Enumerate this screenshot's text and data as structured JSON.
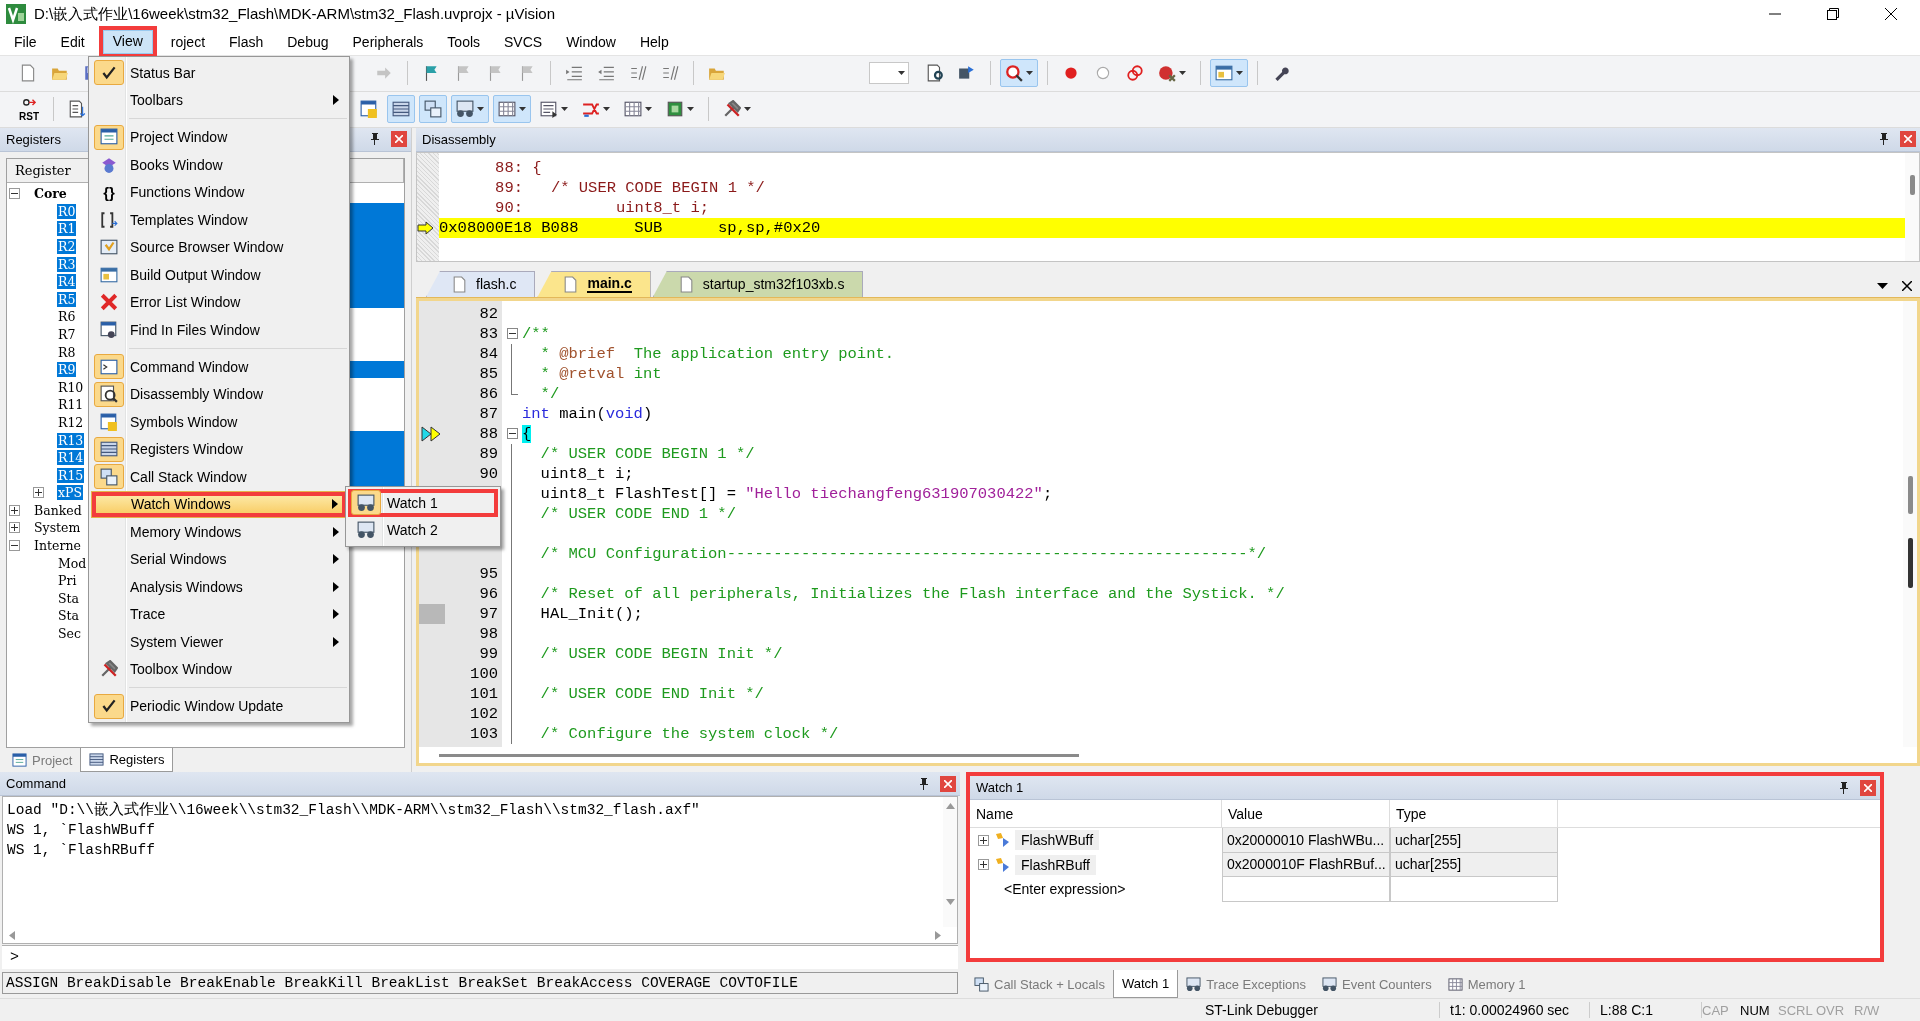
{
  "window": {
    "title": "D:\\嵌入式作业\\16week\\stm32_Flash\\MDK-ARM\\stm32_Flash.uvprojx - µVision"
  },
  "menu_bar": [
    {
      "label": "File",
      "selected": false,
      "highlighted": false
    },
    {
      "label": "Edit",
      "selected": false,
      "highlighted": false
    },
    {
      "label": "View",
      "selected": true,
      "highlighted": true
    },
    {
      "label": "roject",
      "selected": false,
      "highlighted": false
    },
    {
      "label": "Flash",
      "selected": false,
      "highlighted": false
    },
    {
      "label": "Debug",
      "selected": false,
      "highlighted": false
    },
    {
      "label": "Peripherals",
      "selected": false,
      "highlighted": false
    },
    {
      "label": "Tools",
      "selected": false,
      "highlighted": false
    },
    {
      "label": "SVCS",
      "selected": false,
      "highlighted": false
    },
    {
      "label": "Window",
      "selected": false,
      "highlighted": false
    },
    {
      "label": "Help",
      "selected": false,
      "highlighted": false
    }
  ],
  "toolbars": [
    {
      "left": [
        {
          "kind": "new",
          "pressed": false
        },
        {
          "kind": "open",
          "pressed": false
        },
        {
          "kind": "save",
          "pressed": false
        }
      ],
      "right": [
        {
          "kind": "arrow",
          "pressed": false
        },
        {
          "kind": "sep"
        },
        {
          "kind": "flag",
          "pressed": false
        },
        {
          "kind": "flag-grey",
          "pressed": false
        },
        {
          "kind": "flag-grey",
          "pressed": false
        },
        {
          "kind": "flag-grey",
          "pressed": false
        },
        {
          "kind": "sep"
        },
        {
          "kind": "indent",
          "pressed": false
        },
        {
          "kind": "outdent",
          "pressed": false
        },
        {
          "kind": "slash",
          "pressed": false
        },
        {
          "kind": "slash",
          "pressed": false
        },
        {
          "kind": "sep"
        },
        {
          "kind": "open",
          "pressed": false
        },
        {
          "kind": "combo"
        },
        {
          "kind": "docsearch",
          "pressed": false
        },
        {
          "kind": "download",
          "pressed": false
        },
        {
          "kind": "sep"
        },
        {
          "kind": "debug",
          "pressed": true,
          "dropdown": true
        },
        {
          "kind": "sep"
        },
        {
          "kind": "dot",
          "pressed": false
        },
        {
          "kind": "circle",
          "pressed": false
        },
        {
          "kind": "rings",
          "pressed": false
        },
        {
          "kind": "killdot",
          "pressed": false,
          "dropdown": true
        },
        {
          "kind": "sep"
        },
        {
          "kind": "window",
          "pressed": true,
          "dropdown": true
        },
        {
          "kind": "sep"
        },
        {
          "kind": "wrench",
          "pressed": false
        }
      ]
    },
    {
      "left": [
        {
          "kind": "reset",
          "pressed": false,
          "label": "RST"
        },
        {
          "kind": "sep"
        },
        {
          "kind": "step",
          "pressed": false
        }
      ],
      "right": [
        {
          "kind": "symbols",
          "pressed": false
        },
        {
          "kind": "registers",
          "pressed": true
        },
        {
          "kind": "stack",
          "pressed": true
        },
        {
          "kind": "spectacles",
          "pressed": true,
          "dropdown": true
        },
        {
          "kind": "grid",
          "pressed": true,
          "dropdown": true
        },
        {
          "kind": "doclines",
          "pressed": false,
          "dropdown": true
        },
        {
          "kind": "arrows",
          "pressed": false,
          "dropdown": true
        },
        {
          "kind": "grid",
          "pressed": false,
          "dropdown": true
        },
        {
          "kind": "chip",
          "pressed": false,
          "dropdown": true
        },
        {
          "kind": "sep"
        },
        {
          "kind": "tools",
          "pressed": false,
          "dropdown": true
        }
      ]
    }
  ],
  "view_menu": {
    "items": [
      {
        "kind": "item",
        "label": "Status Bar",
        "framed": true,
        "selected": false,
        "highlighted": false
      },
      {
        "kind": "submenu",
        "label": "Toolbars",
        "selected": false,
        "highlighted": false
      },
      {
        "kind": "separator"
      },
      {
        "kind": "item",
        "label": "Project Window",
        "framed": true,
        "selected": false,
        "highlighted": false
      },
      {
        "kind": "item",
        "label": "Books Window",
        "framed": false,
        "selected": false,
        "highlighted": false
      },
      {
        "kind": "item",
        "label": "Functions Window",
        "glyph": "{}",
        "framed": false,
        "selected": false,
        "highlighted": false
      },
      {
        "kind": "item",
        "label": "Templates Window",
        "framed": false,
        "selected": false,
        "highlighted": false
      },
      {
        "kind": "item",
        "label": "Source Browser Window",
        "framed": false,
        "selected": false,
        "highlighted": false
      },
      {
        "kind": "item",
        "label": "Build Output Window",
        "framed": false,
        "selected": false,
        "highlighted": false
      },
      {
        "kind": "item",
        "label": "Error List Window",
        "framed": false,
        "selected": false,
        "highlighted": false
      },
      {
        "kind": "item",
        "label": "Find In Files Window",
        "framed": false,
        "selected": false,
        "highlighted": false
      },
      {
        "kind": "separator"
      },
      {
        "kind": "item",
        "label": "Command Window",
        "framed": true,
        "selected": false,
        "highlighted": false
      },
      {
        "kind": "item",
        "label": "Disassembly Window",
        "framed": true,
        "selected": false,
        "highlighted": false
      },
      {
        "kind": "item",
        "label": "Symbols Window",
        "framed": false,
        "selected": false,
        "highlighted": false
      },
      {
        "kind": "item",
        "label": "Registers Window",
        "framed": true,
        "selected": false,
        "highlighted": false
      },
      {
        "kind": "item",
        "label": "Call Stack Window",
        "framed": true,
        "selected": false,
        "highlighted": false
      },
      {
        "kind": "submenu",
        "label": "Watch Windows",
        "selected": true,
        "highlighted": true
      },
      {
        "kind": "submenu",
        "label": "Memory Windows",
        "selected": false,
        "highlighted": false
      },
      {
        "kind": "submenu",
        "label": "Serial Windows",
        "selected": false,
        "highlighted": false
      },
      {
        "kind": "submenu",
        "label": "Analysis Windows",
        "selected": false,
        "highlighted": false
      },
      {
        "kind": "submenu",
        "label": "Trace",
        "selected": false,
        "highlighted": false
      },
      {
        "kind": "submenu",
        "label": "System Viewer",
        "selected": false,
        "highlighted": false
      },
      {
        "kind": "item",
        "label": "Toolbox Window",
        "framed": false,
        "selected": false,
        "highlighted": false
      },
      {
        "kind": "separator"
      },
      {
        "kind": "item",
        "label": "Periodic Window Update",
        "framed": true,
        "selected": false,
        "highlighted": false
      }
    ]
  },
  "watch_submenu": {
    "items": [
      {
        "label": "Watch 1",
        "framed": true,
        "selected": false,
        "highlighted": true
      },
      {
        "label": "Watch 2",
        "framed": false,
        "selected": false,
        "highlighted": false
      }
    ]
  },
  "registers_pane": {
    "title": "Registers",
    "column": "Register",
    "tree": [
      {
        "label": "Core",
        "expanded": true,
        "selected": false,
        "children": [
          {
            "label": "R0",
            "selected": true
          },
          {
            "label": "R1",
            "selected": true
          },
          {
            "label": "R2",
            "selected": true
          },
          {
            "label": "R3",
            "selected": true
          },
          {
            "label": "R4",
            "selected": true
          },
          {
            "label": "R5",
            "selected": true
          },
          {
            "label": "R6",
            "selected": false
          },
          {
            "label": "R7",
            "selected": false
          },
          {
            "label": "R8",
            "selected": false
          },
          {
            "label": "R9",
            "selected": true
          },
          {
            "label": "R10",
            "selected": false
          },
          {
            "label": "R11",
            "selected": false
          },
          {
            "label": "R12",
            "selected": false
          },
          {
            "label": "R13",
            "selected": true
          },
          {
            "label": "R14",
            "selected": true
          },
          {
            "label": "R15",
            "selected": true
          },
          {
            "label": "xPS",
            "selected": true,
            "expanded": false
          }
        ]
      },
      {
        "label": "Banked",
        "expanded": false,
        "selected": false
      },
      {
        "label": "System",
        "expanded": false,
        "selected": false
      },
      {
        "label": "Interne",
        "expanded": true,
        "selected": false,
        "children": [
          {
            "label": "Mod",
            "selected": false
          },
          {
            "label": "Pri",
            "selected": false
          },
          {
            "label": "Sta",
            "selected": false
          },
          {
            "label": "Sta",
            "selected": false
          },
          {
            "label": "Sec",
            "selected": false
          }
        ]
      }
    ],
    "tabs": [
      {
        "label": "Project",
        "selected": false
      },
      {
        "label": "Registers",
        "selected": true
      }
    ]
  },
  "disassembly_pane": {
    "title": "Disassembly",
    "lines": [
      {
        "kind": "source",
        "number": "88:",
        "text": " {",
        "current": false
      },
      {
        "kind": "source",
        "number": "89:",
        "text": "   /* USER CODE BEGIN 1 */",
        "current": false
      },
      {
        "kind": "source",
        "number": "90:",
        "text": "          uint8_t i;",
        "current": false
      },
      {
        "kind": "instruction",
        "text": "0x08000E18 B088      SUB      sp,sp,#0x20",
        "current": true
      }
    ]
  },
  "editor": {
    "tabs": [
      {
        "label": "flash.c",
        "selected": false,
        "color": "#dfe7f5"
      },
      {
        "label": "main.c",
        "selected": true,
        "color": "#fbe58c"
      },
      {
        "label": "startup_stm32f103xb.s",
        "selected": false,
        "color": "#cbd9ac"
      }
    ],
    "lines": [
      {
        "number": "82",
        "current": false,
        "covered": false
      },
      {
        "number": "83",
        "folded": false,
        "current": false,
        "covered": false,
        "segments": [
          {
            "kind": "comment",
            "text": "/**"
          }
        ]
      },
      {
        "number": "84",
        "fold_end": false,
        "current": false,
        "covered": false,
        "segments": [
          {
            "kind": "comment",
            "text": "  * "
          },
          {
            "kind": "tag",
            "text": "@brief"
          },
          {
            "kind": "comment",
            "text": "  The application entry point."
          }
        ]
      },
      {
        "number": "85",
        "fold_end": false,
        "current": false,
        "covered": false,
        "segments": [
          {
            "kind": "comment",
            "text": "  * "
          },
          {
            "kind": "tag",
            "text": "@retval"
          },
          {
            "kind": "comment",
            "text": " int"
          }
        ]
      },
      {
        "number": "86",
        "fold_end": true,
        "current": false,
        "covered": false,
        "segments": [
          {
            "kind": "comment",
            "text": "  */"
          }
        ]
      },
      {
        "number": "87",
        "current": false,
        "covered": false,
        "segments": [
          {
            "kind": "keyword",
            "text": "int"
          },
          {
            "kind": "plain",
            "text": " main("
          },
          {
            "kind": "keyword",
            "text": "void"
          },
          {
            "kind": "plain",
            "text": ")"
          }
        ]
      },
      {
        "number": "88",
        "folded": false,
        "current": true,
        "covered": false,
        "segments": [
          {
            "kind": "brace",
            "text": "{"
          }
        ]
      },
      {
        "number": "89",
        "fold_end": false,
        "current": false,
        "covered": false,
        "segments": [
          {
            "kind": "comment",
            "text": "  /* USER CODE BEGIN 1 */"
          }
        ]
      },
      {
        "number": "90",
        "fold_end": false,
        "current": false,
        "covered": false,
        "segments": [
          {
            "kind": "plain",
            "text": "  uint8_t i;"
          }
        ]
      },
      {
        "fold_end": false,
        "segments": [
          {
            "kind": "plain",
            "text": "  uint8_t FlashTest[] = "
          },
          {
            "kind": "string",
            "text": "\"Hello tiechangfeng631907030422\""
          },
          {
            "kind": "plain",
            "text": ";"
          }
        ]
      },
      {
        "fold_end": false,
        "segments": [
          {
            "kind": "comment",
            "text": "  /* USER CODE END 1 */"
          }
        ]
      },
      {
        "fold_end": false
      },
      {
        "fold_end": false,
        "current": false,
        "covered": false,
        "segments": [
          {
            "kind": "comment",
            "text": "  /* MCU Configuration--------------------------------------------------------*/"
          }
        ]
      },
      {
        "number": "95",
        "fold_end": false,
        "current": false,
        "covered": false
      },
      {
        "number": "96",
        "fold_end": false,
        "current": false,
        "covered": false,
        "segments": [
          {
            "kind": "comment",
            "text": "  /* Reset of all peripherals, Initializes the Flash interface and the Systick. */"
          }
        ]
      },
      {
        "number": "97",
        "fold_end": false,
        "current": false,
        "covered": true,
        "segments": [
          {
            "kind": "plain",
            "text": "  HAL_Init();"
          }
        ]
      },
      {
        "number": "98",
        "fold_end": false,
        "current": false,
        "covered": false
      },
      {
        "number": "99",
        "fold_end": false,
        "current": false,
        "covered": false,
        "segments": [
          {
            "kind": "comment",
            "text": "  /* USER CODE BEGIN Init */"
          }
        ]
      },
      {
        "number": "100",
        "fold_end": false,
        "current": false,
        "covered": false
      },
      {
        "number": "101",
        "fold_end": false,
        "current": false,
        "covered": false,
        "segments": [
          {
            "kind": "comment",
            "text": "  /* USER CODE END Init */"
          }
        ]
      },
      {
        "number": "102",
        "fold_end": false,
        "current": false,
        "covered": false
      },
      {
        "number": "103",
        "fold_end": false,
        "current": false,
        "covered": false,
        "segments": [
          {
            "kind": "comment",
            "text": "  /* Configure the system clock */"
          }
        ]
      }
    ]
  },
  "command_pane": {
    "title": "Command",
    "output": [
      "Load \"D:\\\\嵌入式作业\\\\16week\\\\stm32_Flash\\\\MDK-ARM\\\\stm32_Flash\\\\stm32_flash.axf\"",
      "WS 1, `FlashWBuff",
      "WS 1, `FlashRBuff"
    ],
    "prompt": ">",
    "hints": "ASSIGN BreakDisable BreakEnable BreakKill BreakList BreakSet BreakAccess COVERAGE COVTOFILE"
  },
  "watch_pane": {
    "title": "Watch 1",
    "highlighted": true,
    "columns": [
      "Name",
      "Value",
      "Type"
    ],
    "rows": [
      {
        "name": "FlashWBuff",
        "value": "0x20000010 FlashWBu...",
        "type": "uchar[255]"
      },
      {
        "name": "FlashRBuff",
        "value": "0x2000010F FlashRBuf...",
        "type": "uchar[255]"
      }
    ],
    "placeholder": "<Enter expression>",
    "tabs": [
      {
        "label": "Call Stack + Locals",
        "selected": false
      },
      {
        "label": "Watch 1",
        "selected": true
      },
      {
        "label": "Trace Exceptions",
        "selected": false
      },
      {
        "label": "Event Counters",
        "selected": false
      },
      {
        "label": "Memory 1",
        "selected": false
      }
    ]
  },
  "status_bar": {
    "debugger": "ST-Link Debugger",
    "time": "t1: 0.00024960 sec",
    "position": "L:88 C:1",
    "indicators": [
      {
        "label": "CAP",
        "on": false
      },
      {
        "label": "NUM",
        "on": true
      },
      {
        "label": "SCRL",
        "on": false
      },
      {
        "label": "OVR",
        "on": false
      },
      {
        "label": "R/W",
        "on": false
      }
    ]
  }
}
